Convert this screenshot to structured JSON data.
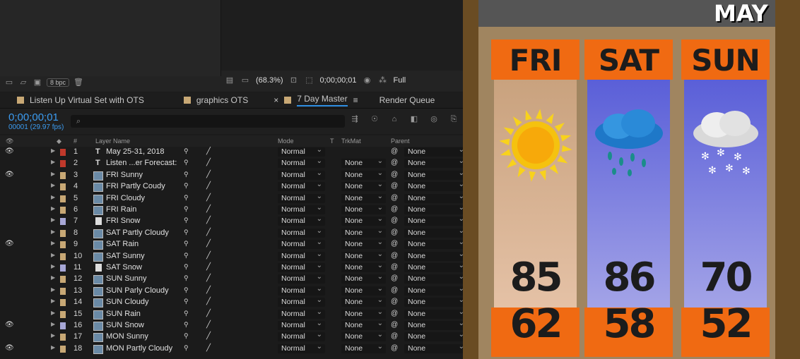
{
  "project_panel": {
    "bpc_label": "8 bpc"
  },
  "comp_toolbar": {
    "zoom": "(68.3%)",
    "timecode": "0;00;00;01",
    "resolution": "Full"
  },
  "tabs": [
    {
      "label": "Listen Up Virtual Set with OTS"
    },
    {
      "label": "graphics OTS"
    },
    {
      "label": "7 Day Master"
    },
    {
      "label": "Render Queue"
    }
  ],
  "timeline": {
    "timecode": "0;00;00;01",
    "frames": "00001 (29.97 fps)",
    "search_placeholder": "",
    "columns": {
      "num": "#",
      "layer_name": "Layer Name",
      "mode": "Mode",
      "t": "T",
      "trkmat": "TrkMat",
      "parent": "Parent"
    },
    "layers": [
      {
        "num": "1",
        "name": "May 25-31, 2018",
        "type": "text",
        "color": "#c0392b",
        "eye": true,
        "mode": "Normal",
        "trkmat": "",
        "parent": "None"
      },
      {
        "num": "2",
        "name": "Listen ...er Forecast:",
        "type": "text",
        "color": "#c0392b",
        "eye": false,
        "mode": "Normal",
        "trkmat": "None",
        "parent": "None"
      },
      {
        "num": "3",
        "name": "FRI Sunny",
        "type": "layer",
        "color": "#c8a875",
        "eye": true,
        "mode": "Normal",
        "trkmat": "None",
        "parent": "None"
      },
      {
        "num": "4",
        "name": "FRI Partly Coudy",
        "type": "layer",
        "color": "#c8a875",
        "eye": false,
        "mode": "Normal",
        "trkmat": "None",
        "parent": "None"
      },
      {
        "num": "5",
        "name": "FRI Cloudy",
        "type": "layer",
        "color": "#c8a875",
        "eye": false,
        "mode": "Normal",
        "trkmat": "None",
        "parent": "None"
      },
      {
        "num": "6",
        "name": "FRI Rain",
        "type": "layer",
        "color": "#c8a875",
        "eye": false,
        "mode": "Normal",
        "trkmat": "None",
        "parent": "None"
      },
      {
        "num": "7",
        "name": "FRI Snow",
        "type": "solid",
        "color": "#a7a7d6",
        "eye": false,
        "mode": "Normal",
        "trkmat": "None",
        "parent": "None"
      },
      {
        "num": "8",
        "name": "SAT Partly Cloudy",
        "type": "layer",
        "color": "#c8a875",
        "eye": false,
        "mode": "Normal",
        "trkmat": "None",
        "parent": "None"
      },
      {
        "num": "9",
        "name": "SAT Rain",
        "type": "layer",
        "color": "#c8a875",
        "eye": true,
        "mode": "Normal",
        "trkmat": "None",
        "parent": "None"
      },
      {
        "num": "10",
        "name": "SAT Sunny",
        "type": "layer",
        "color": "#c8a875",
        "eye": false,
        "mode": "Normal",
        "trkmat": "None",
        "parent": "None"
      },
      {
        "num": "11",
        "name": "SAT Snow",
        "type": "solid",
        "color": "#a7a7d6",
        "eye": false,
        "mode": "Normal",
        "trkmat": "None",
        "parent": "None"
      },
      {
        "num": "12",
        "name": "SUN Sunny",
        "type": "layer",
        "color": "#c8a875",
        "eye": false,
        "mode": "Normal",
        "trkmat": "None",
        "parent": "None"
      },
      {
        "num": "13",
        "name": "SUN Parly Cloudy",
        "type": "layer",
        "color": "#c8a875",
        "eye": false,
        "mode": "Normal",
        "trkmat": "None",
        "parent": "None"
      },
      {
        "num": "14",
        "name": "SUN Cloudy",
        "type": "layer",
        "color": "#c8a875",
        "eye": false,
        "mode": "Normal",
        "trkmat": "None",
        "parent": "None"
      },
      {
        "num": "15",
        "name": "SUN Rain",
        "type": "layer",
        "color": "#c8a875",
        "eye": false,
        "mode": "Normal",
        "trkmat": "None",
        "parent": "None"
      },
      {
        "num": "16",
        "name": "SUN Snow",
        "type": "layer",
        "color": "#a7a7d6",
        "eye": true,
        "mode": "Normal",
        "trkmat": "None",
        "parent": "None"
      },
      {
        "num": "17",
        "name": "MON Sunny",
        "type": "layer",
        "color": "#c8a875",
        "eye": false,
        "mode": "Normal",
        "trkmat": "None",
        "parent": "None"
      },
      {
        "num": "18",
        "name": "MON Partly Cloudy",
        "type": "layer",
        "color": "#c8a875",
        "eye": true,
        "mode": "Normal",
        "trkmat": "None",
        "parent": "None"
      }
    ]
  },
  "forecast": {
    "month": "MAY",
    "days": [
      {
        "day": "FRI",
        "icon": "sun-icon",
        "high": "85",
        "low": "62"
      },
      {
        "day": "SAT",
        "icon": "rain-cloud-icon",
        "high": "86",
        "low": "58"
      },
      {
        "day": "SUN",
        "icon": "snow-cloud-icon",
        "high": "70",
        "low": "52"
      }
    ]
  }
}
